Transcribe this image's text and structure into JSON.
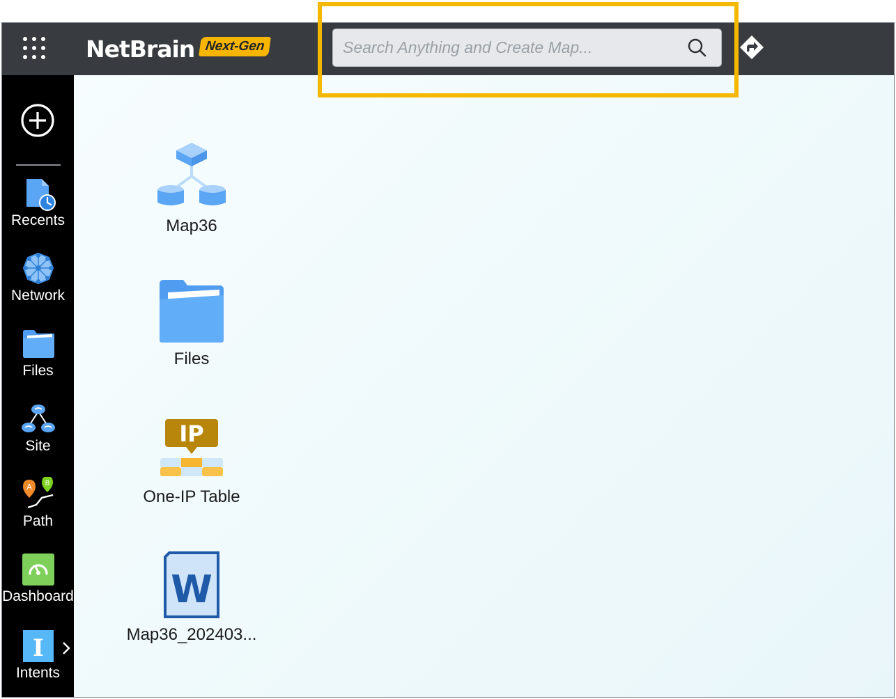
{
  "header": {
    "logo_text": "NetBrain",
    "logo_badge": "Next-Gen",
    "search_placeholder": "Search Anything and Create Map..."
  },
  "sidebar": {
    "items": [
      {
        "label": "Recents",
        "icon": "recents-icon"
      },
      {
        "label": "Network",
        "icon": "network-icon"
      },
      {
        "label": "Files",
        "icon": "files-icon"
      },
      {
        "label": "Site",
        "icon": "site-icon"
      },
      {
        "label": "Path",
        "icon": "path-icon"
      },
      {
        "label": "Dashboard",
        "icon": "dashboard-icon"
      },
      {
        "label": "Intents",
        "icon": "intents-icon"
      }
    ],
    "intents_glyph": "I",
    "path_markers": [
      "A",
      "B"
    ]
  },
  "desktop": {
    "items": [
      {
        "label": "Map36",
        "icon": "map-icon"
      },
      {
        "label": "Files",
        "icon": "folder-icon"
      },
      {
        "label": "One-IP Table",
        "icon": "one-ip-table-icon"
      },
      {
        "label": "Map36_202403...",
        "icon": "word-document-icon"
      }
    ],
    "ip_glyph": "IP",
    "word_glyph": "W"
  },
  "colors": {
    "topbar": "#383c41",
    "sidebar": "#000000",
    "highlight": "#f5b800",
    "badge": "#f7b500",
    "icon_blue": "#5aa6f4",
    "content_bg": "#eef8fb"
  }
}
